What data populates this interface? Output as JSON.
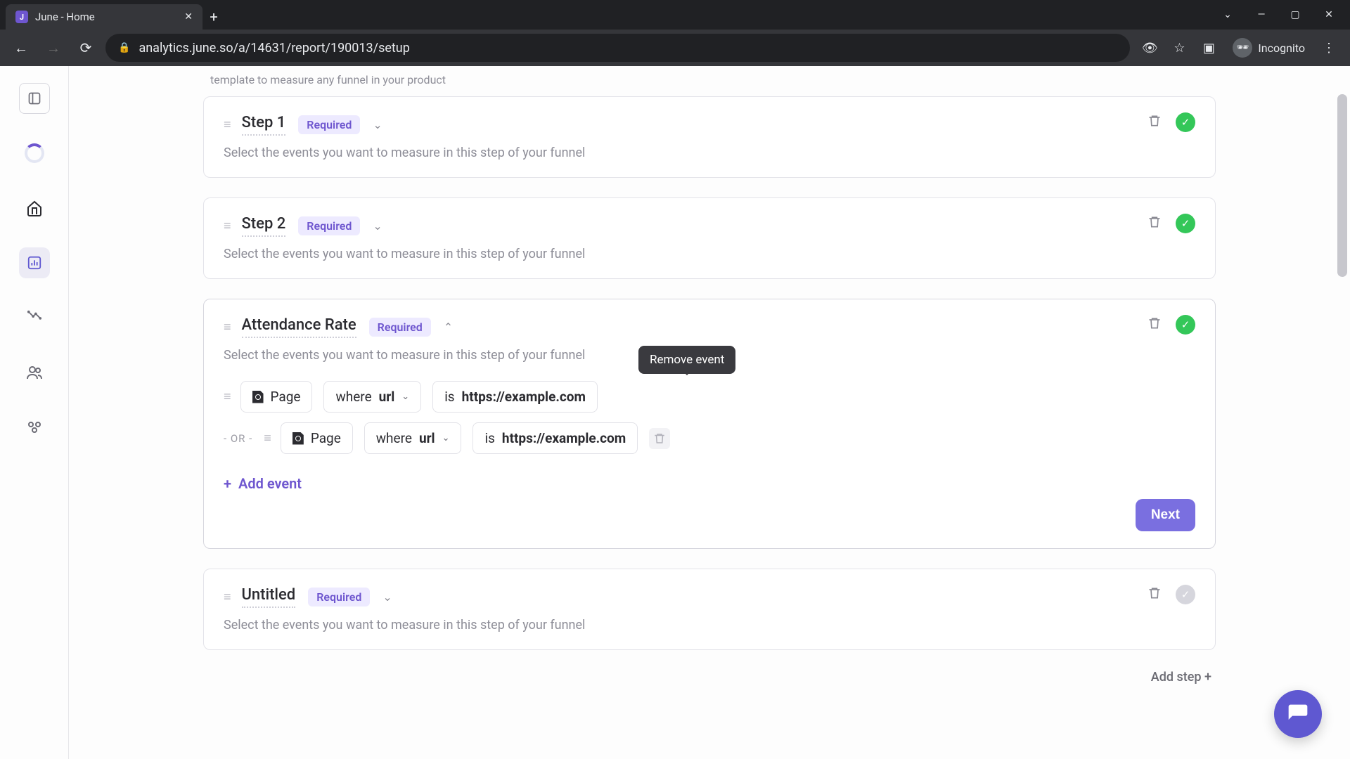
{
  "browser": {
    "tab_title": "June - Home",
    "url": "analytics.june.so/a/14631/report/190013/setup",
    "incognito_label": "Incognito"
  },
  "page": {
    "subheading_partial": "template to measure any funnel in your product"
  },
  "sidebar": {
    "items": [
      {
        "name": "toggle-panel-icon"
      },
      {
        "name": "loading-spinner-icon"
      },
      {
        "name": "home-icon"
      },
      {
        "name": "reports-icon"
      },
      {
        "name": "insights-icon"
      },
      {
        "name": "users-icon"
      },
      {
        "name": "groups-icon"
      }
    ]
  },
  "steps": [
    {
      "title": "Step 1",
      "required_label": "Required",
      "desc": "Select the events you want to measure in this step of your funnel",
      "expanded": false,
      "complete": true
    },
    {
      "title": "Step 2",
      "required_label": "Required",
      "desc": "Select the events you want to measure in this step of your funnel",
      "expanded": false,
      "complete": true
    },
    {
      "title": "Attendance Rate",
      "required_label": "Required",
      "desc": "Select the events you want to measure in this step of your funnel",
      "expanded": true,
      "complete": true,
      "events": [
        {
          "type_label": "Page",
          "where_label": "where",
          "prop": "url",
          "op": "is",
          "value": "https://example.com"
        },
        {
          "or_label": "- OR -",
          "type_label": "Page",
          "where_label": "where",
          "prop": "url",
          "op": "is",
          "value": "https://example.com"
        }
      ],
      "add_event_label": "Add event",
      "next_label": "Next",
      "remove_tooltip": "Remove event"
    },
    {
      "title": "Untitled",
      "required_label": "Required",
      "desc": "Select the events you want to measure in this step of your funnel",
      "expanded": false,
      "complete": false
    }
  ],
  "footer": {
    "add_step_label": "Add step"
  }
}
